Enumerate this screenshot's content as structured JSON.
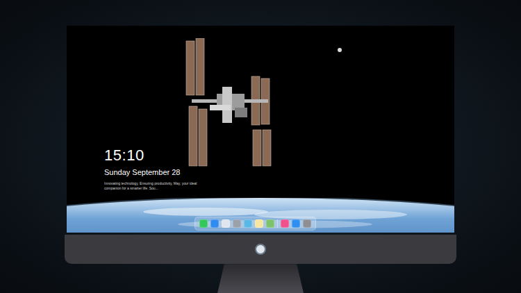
{
  "lock_screen": {
    "time": "15:10",
    "date": "Sunday September 28",
    "tagline": "Innovating technology, Ensuring productivity, May, your ideal companion for a smarter life. Sou..."
  },
  "dock": {
    "groups": [
      {
        "items": [
          {
            "color": "#34c759"
          },
          {
            "color": "#2f8bf0"
          },
          {
            "color": "#dfe6ee"
          },
          {
            "color": "#9aa1ab"
          },
          {
            "color": "#5bb8e6"
          },
          {
            "color": "#f5e7a1"
          },
          {
            "color": "#7cc36b"
          }
        ]
      },
      {
        "items": [
          {
            "color": "#f0508c"
          },
          {
            "color": "#2f8ff0"
          },
          {
            "color": "#8c8f96"
          }
        ]
      }
    ]
  }
}
